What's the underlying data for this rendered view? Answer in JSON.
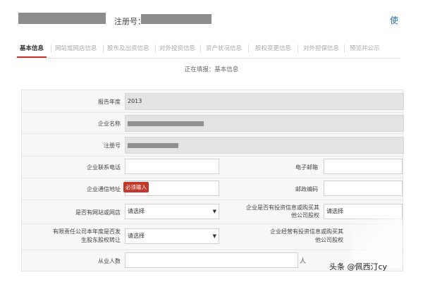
{
  "header": {
    "reg_label": "注册号：",
    "corner_link": "使"
  },
  "tabs": [
    {
      "label": "基本信息",
      "active": true
    },
    {
      "label": "网站或网店信息",
      "active": false
    },
    {
      "label": "股东及出资信息",
      "active": false
    },
    {
      "label": "对外投资信息",
      "active": false
    },
    {
      "label": "资产状况信息",
      "active": false
    },
    {
      "label": "股权变更信息",
      "active": false
    },
    {
      "label": "对外担保信息",
      "active": false
    },
    {
      "label": "预览并公示",
      "active": false
    }
  ],
  "filling_status": "正在填报：基本信息",
  "form": {
    "year_label": "报告年度",
    "year_value": "2013",
    "company_name_label": "企业名称",
    "reg_no_label": "注册号",
    "phone_label": "企业联系电话",
    "email_label": "电子邮箱",
    "address_label": "企业通信地址",
    "address_error": "必须输入",
    "zip_label": "邮政编码",
    "website_label": "是否有网站或网店",
    "website_select": "请选择",
    "invest_label": "企业是否有投资信息或购买其他公司股权",
    "invest_select": "请选择",
    "equity_label": "有限责任公司本年度是否发生股东股权转让",
    "equity_select": "请选择",
    "invest2_label": "企业经营有投资信息或购买其他公司股权",
    "employees_label": "从业人数",
    "employees_unit": "人"
  },
  "watermark": "头条 @佩西汀cy"
}
